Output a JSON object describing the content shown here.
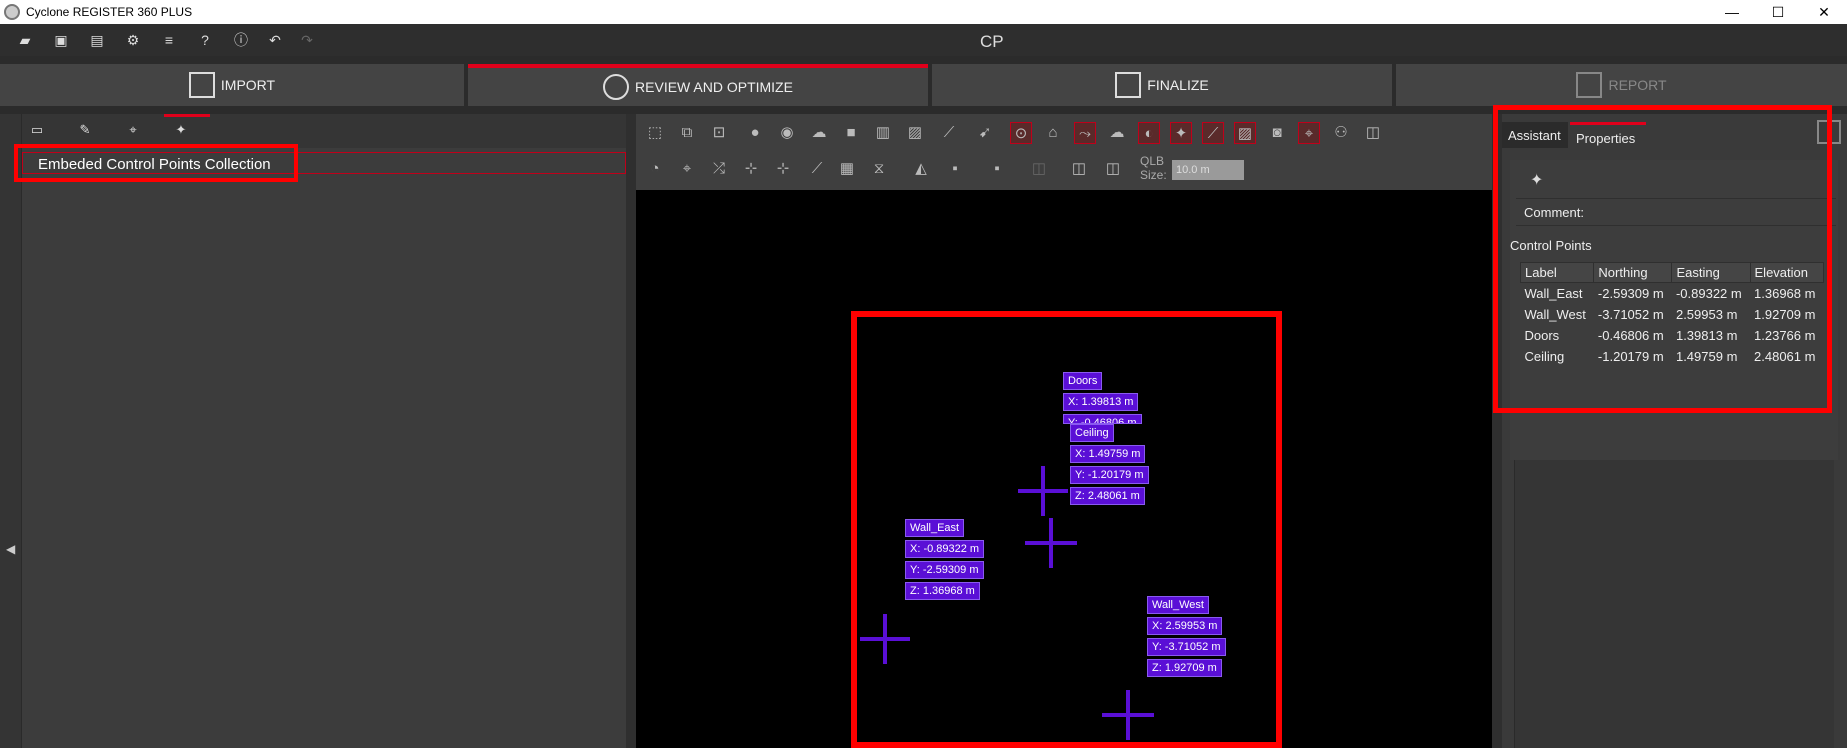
{
  "window": {
    "title": "Cyclone REGISTER 360 PLUS",
    "minimize": "—",
    "maximize": "☐",
    "close": "✕"
  },
  "document_title": "CP",
  "steps": [
    {
      "label": "IMPORT",
      "icon": "import-icon"
    },
    {
      "label": "REVIEW AND OPTIMIZE",
      "icon": "review-icon"
    },
    {
      "label": "FINALIZE",
      "icon": "finalize-icon"
    },
    {
      "label": "REPORT",
      "icon": "report-icon"
    }
  ],
  "left_panel": {
    "collection_label": "Embeded Control Points Collection",
    "collapse_arrow": "◀"
  },
  "viewport": {
    "qlb_label": "QLB",
    "size_label": "Size:",
    "qlb_size": "10.0 m",
    "tags": [
      {
        "label": "Doors",
        "x": "X: 1.39813 m",
        "y": "Y: -0.46806 m"
      },
      {
        "label": "Ceiling",
        "x": "X: 1.49759 m",
        "y": "Y: -1.20179 m",
        "z": "Z: 2.48061 m"
      },
      {
        "label": "Wall_East",
        "x": "X: -0.89322 m",
        "y": "Y: -2.59309 m",
        "z": "Z: 1.36968 m"
      },
      {
        "label": "Wall_West",
        "x": "X: 2.59953 m",
        "y": "Y: -3.71052 m",
        "z": "Z: 1.92709 m"
      }
    ]
  },
  "right_panel": {
    "tabs": {
      "assistant": "Assistant",
      "properties": "Properties"
    },
    "comment_label": "Comment:",
    "control_points_title": "Control Points",
    "columns": [
      "Label",
      "Northing",
      "Easting",
      "Elevation"
    ],
    "rows": [
      [
        "Wall_East",
        "-2.59309 m",
        "-0.89322 m",
        "1.36968 m"
      ],
      [
        "Wall_West",
        "-3.71052 m",
        "2.59953 m",
        "1.92709 m"
      ],
      [
        "Doors",
        "-0.46806 m",
        "1.39813 m",
        "1.23766 m"
      ],
      [
        "Ceiling",
        "-1.20179 m",
        "1.49759 m",
        "2.48061 m"
      ]
    ]
  },
  "colors": {
    "accent_red": "#e0001b",
    "highlight_red": "#ff0000",
    "tag_purple": "#5a0fd6"
  }
}
